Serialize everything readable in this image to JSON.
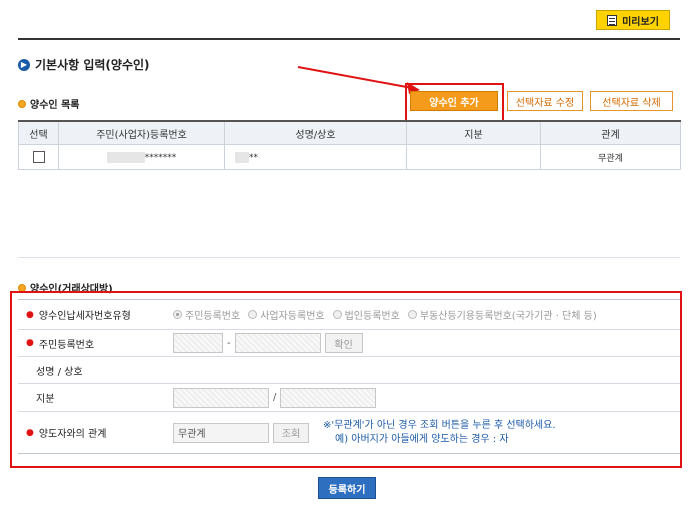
{
  "toolbar": {
    "preview_label": "미리보기"
  },
  "section": {
    "title": "기본사항 입력(양수인)"
  },
  "list": {
    "title": "양수인 목록",
    "buttons": {
      "add": "양수인 추가",
      "edit": "선택자료 수정",
      "delete": "선택자료 삭제"
    },
    "columns": [
      "선택",
      "주민(사업자)등록번호",
      "성명/상호",
      "지분",
      "관계"
    ],
    "rows": [
      {
        "id_masked": "*******",
        "name_masked": "**",
        "share": "",
        "relation": "무관계"
      }
    ]
  },
  "form": {
    "title": "양수인(거래상대방)",
    "taxpayer_type": {
      "label": "양수인납세자번호유형",
      "options": [
        "주민등록번호",
        "사업자등록번호",
        "법인등록번호",
        "부동산등기용등록번호(국가기관 · 단체 등)"
      ],
      "selected": "주민등록번호"
    },
    "resident_no": {
      "label": "주민등록번호",
      "separator": "-",
      "check_button": "확인"
    },
    "name": {
      "label": "성명 / 상호"
    },
    "share": {
      "label": "지분",
      "separator": "/"
    },
    "relation": {
      "label": "양도자와의 관계",
      "value": "무관계",
      "lookup_button": "조회",
      "note_line1": "※'무관계'가 아닌 경우 조회 버튼을 누른 후 선택하세요.",
      "note_line2": "예) 아버지가 아들에게 양도하는 경우 : 자"
    },
    "submit_label": "등록하기"
  },
  "colors": {
    "accent_orange": "#f59b1b",
    "highlight_red": "#e01212",
    "primary_blue": "#2e6fc0",
    "preview_yellow": "#ffd200"
  }
}
